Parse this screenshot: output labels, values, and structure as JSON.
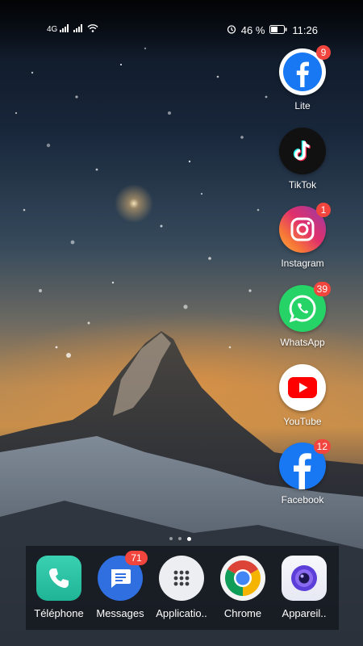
{
  "status_bar": {
    "network": "4G",
    "battery_percent": "46 %",
    "time": "11:26",
    "icons": [
      "signal-icon",
      "wifi-icon",
      "alarm-icon",
      "battery-icon"
    ]
  },
  "home_apps": [
    {
      "label": "Lite",
      "badge": "9",
      "icon": "facebook-lite-icon"
    },
    {
      "label": "TikTok",
      "badge": "",
      "icon": "tiktok-icon"
    },
    {
      "label": "Instagram",
      "badge": "1",
      "icon": "instagram-icon"
    },
    {
      "label": "WhatsApp",
      "badge": "39",
      "icon": "whatsapp-icon"
    },
    {
      "label": "YouTube",
      "badge": "",
      "icon": "youtube-icon"
    },
    {
      "label": "Facebook",
      "badge": "12",
      "icon": "facebook-icon"
    }
  ],
  "page_indicator": {
    "pages": 3,
    "active": 3
  },
  "dock": [
    {
      "label": "Téléphone",
      "badge": "",
      "icon": "phone-icon"
    },
    {
      "label": "Messages",
      "badge": "71",
      "icon": "messages-icon"
    },
    {
      "label": "Applicatio..",
      "badge": "",
      "icon": "app-drawer-icon"
    },
    {
      "label": "Chrome",
      "badge": "",
      "icon": "chrome-icon"
    },
    {
      "label": "Appareil..",
      "badge": "",
      "icon": "camera-icon"
    }
  ],
  "colors": {
    "badge": "#f1453d",
    "facebook": "#1877f2",
    "whatsapp": "#25d366",
    "youtube": "#ff0000",
    "phone": "#29c3a6",
    "messages": "#2f6fe0"
  }
}
